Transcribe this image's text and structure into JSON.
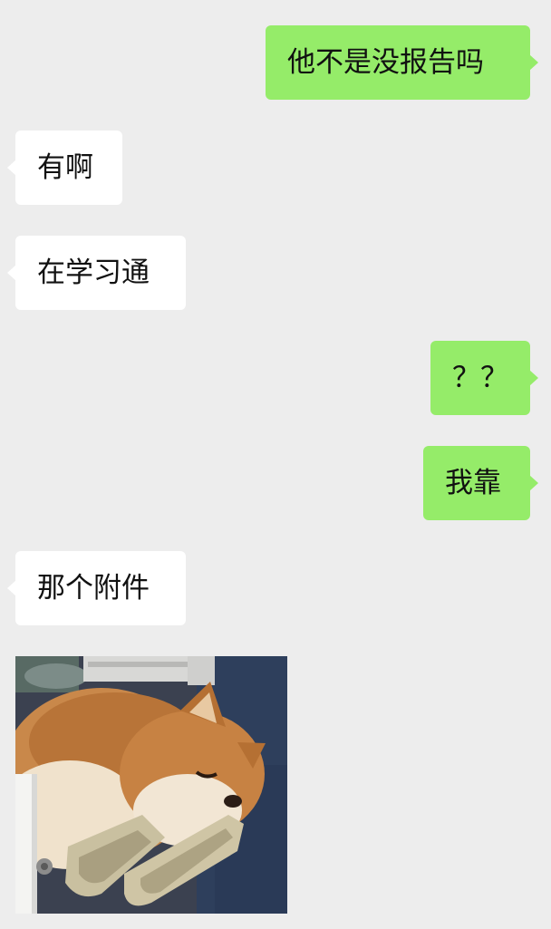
{
  "chat": {
    "messages": [
      {
        "side": "out",
        "text": "他不是没报告吗"
      },
      {
        "side": "in",
        "text": "有啊"
      },
      {
        "side": "in",
        "text": "在学习通"
      },
      {
        "side": "out",
        "text": "？？"
      },
      {
        "side": "out",
        "text": "我靠"
      },
      {
        "side": "in",
        "text": "那个附件"
      }
    ],
    "sticker": {
      "description_icon": "shiba-dog-sticker"
    }
  },
  "colors": {
    "background": "#ededed",
    "outgoing_bubble": "#95ec69",
    "incoming_bubble": "#ffffff",
    "text": "#111111"
  }
}
